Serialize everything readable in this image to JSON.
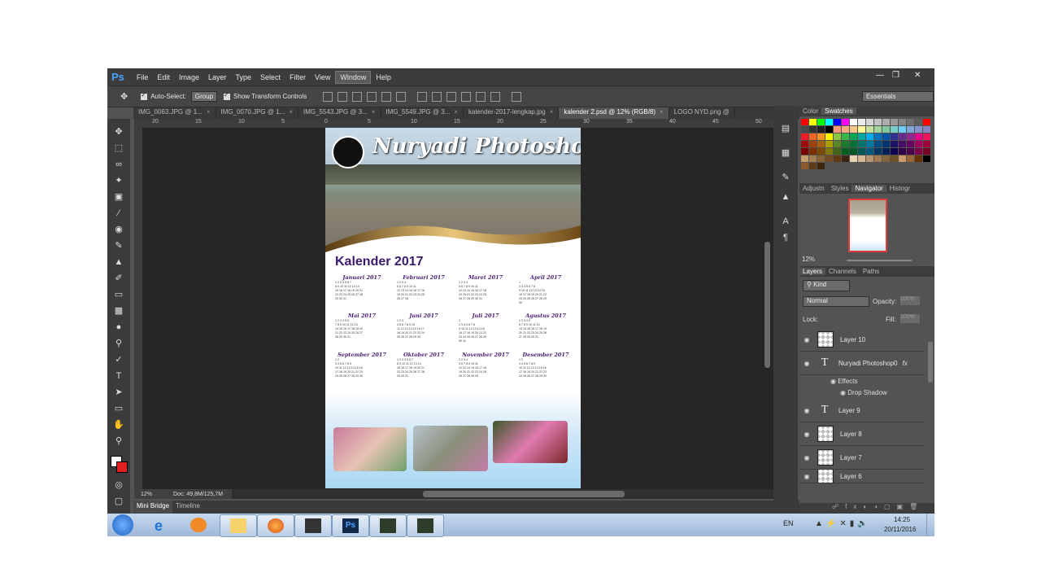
{
  "app": {
    "logo": "Ps",
    "menu": [
      "File",
      "Edit",
      "Image",
      "Layer",
      "Type",
      "Select",
      "Filter",
      "View",
      "Window",
      "Help"
    ],
    "active_menu": "Window"
  },
  "options": {
    "auto_select_label": "Auto-Select:",
    "auto_select_value": "Group",
    "transform_label": "Show Transform Controls",
    "workspace": "Essentials"
  },
  "tabs": [
    {
      "label": "IMG_0063.JPG @ 1..."
    },
    {
      "label": "IMG_0070.JPG @ 1..."
    },
    {
      "label": "IMG_5543.JPG @ 3..."
    },
    {
      "label": "IMG_5549.JPG @ 3..."
    },
    {
      "label": "kalender-2017-lengkap.jpg"
    },
    {
      "label": "kalender 2.psd @ 12% (RGB/8)"
    },
    {
      "label": "LOGO NYD.png @ "
    }
  ],
  "ruler": {
    "marks": [
      "20",
      "15",
      "10",
      "5",
      "0",
      "5",
      "10",
      "15",
      "20",
      "25",
      "30",
      "35",
      "40",
      "45",
      "50"
    ]
  },
  "document": {
    "brand": "Nuryadi Photoshop",
    "title": "Kalender 2017",
    "months": [
      "Januari 2017",
      "Februari 2017",
      "Maret 2017",
      "April 2017",
      "Mai 2017",
      "Juni 2017",
      "Juli 2017",
      "Agustus 2017",
      "September 2017",
      "Oktober 2017",
      "November 2017",
      "Desember 2017"
    ]
  },
  "status": {
    "zoom": "12%",
    "doc": "Doc: 49,8M/125,7M"
  },
  "bottom_tabs": [
    "Mini Bridge",
    "Timeline"
  ],
  "panels": {
    "color_tabs": [
      "Color",
      "Swatches"
    ],
    "nav_tabs": [
      "Adjustn",
      "Styles",
      "Navigator",
      "Histogr"
    ],
    "nav_zoom": "12%",
    "layer_tabs": [
      "Layers",
      "Channels",
      "Paths"
    ],
    "kind": "Kind",
    "blend": "Normal",
    "opacity_label": "Opacity:",
    "opacity_value": "100%",
    "lock_label": "Lock:",
    "fill_label": "Fill:",
    "fill_value": "100%",
    "layers": [
      {
        "name": "Layer 10",
        "type": "pixel"
      },
      {
        "name": "Nuryadi Photoshop0",
        "type": "text"
      },
      {
        "name": "Layer 9",
        "type": "text"
      },
      {
        "name": "Layer 8",
        "type": "pixel"
      },
      {
        "name": "Layer 7",
        "type": "pixel"
      },
      {
        "name": "Layer 6",
        "type": "pixel"
      }
    ],
    "effects_label": "Effects",
    "drop_shadow_label": "Drop Shadow"
  },
  "taskbar": {
    "lang": "EN",
    "time": "14:25",
    "date": "20/11/2016"
  }
}
